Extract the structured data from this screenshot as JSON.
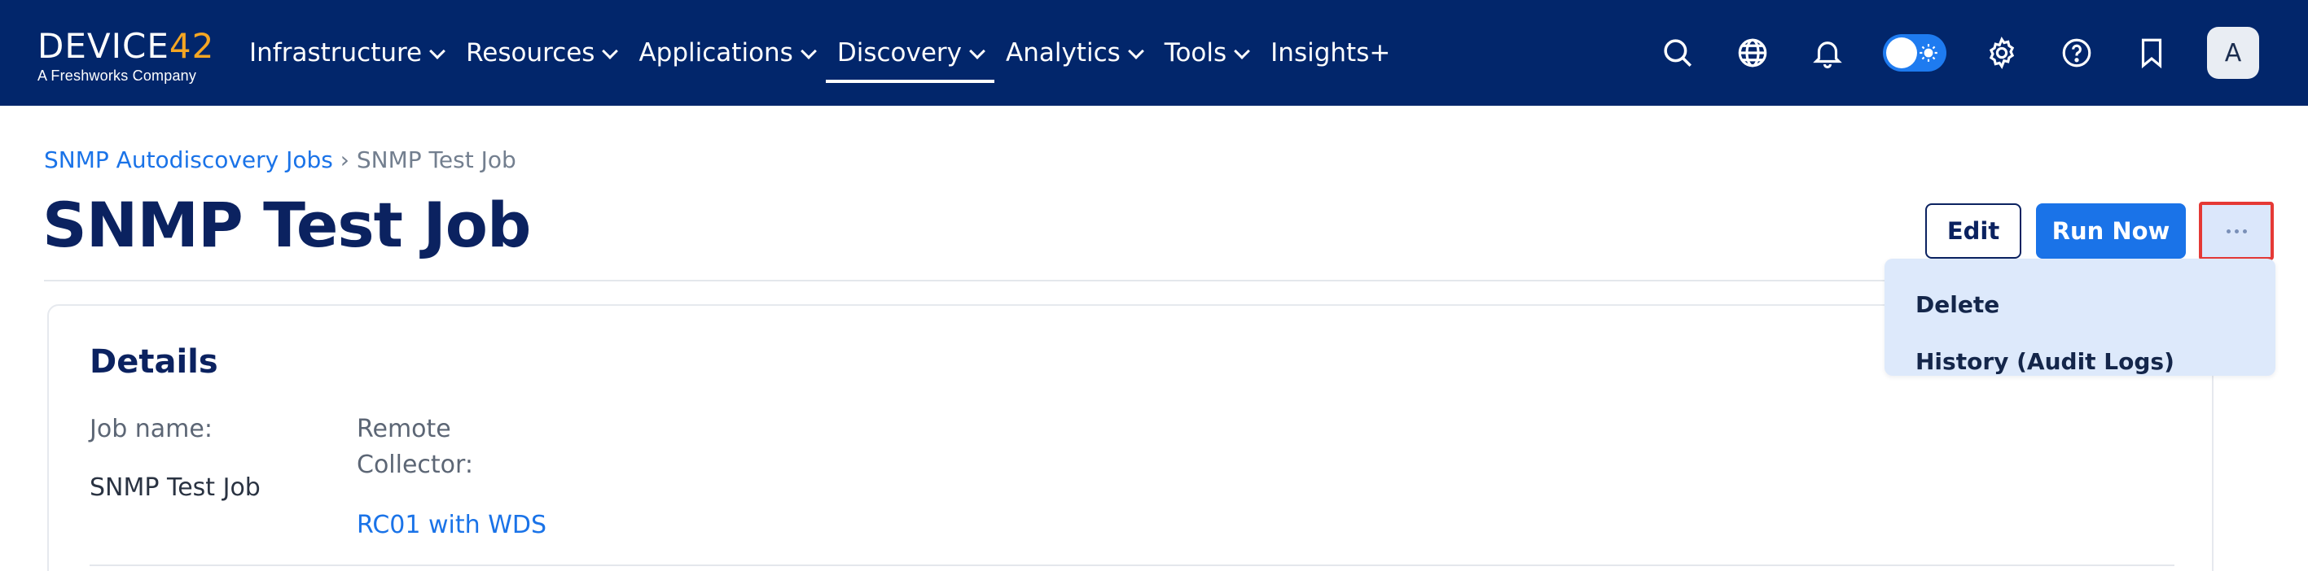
{
  "nav": {
    "logo_main_a": "DEVICE",
    "logo_main_b": "42",
    "logo_sub": "A Freshworks Company",
    "items": [
      {
        "label": "Infrastructure",
        "has_chevron": true
      },
      {
        "label": "Resources",
        "has_chevron": true
      },
      {
        "label": "Applications",
        "has_chevron": true
      },
      {
        "label": "Discovery",
        "has_chevron": true,
        "active": true
      },
      {
        "label": "Analytics",
        "has_chevron": true
      },
      {
        "label": "Tools",
        "has_chevron": true
      },
      {
        "label": "Insights+",
        "has_chevron": false
      }
    ],
    "icons": [
      "search-icon",
      "globe-icon",
      "bell-icon",
      "theme-toggle",
      "gear-icon",
      "help-icon",
      "bookmark-icon"
    ],
    "avatar_initial": "A"
  },
  "breadcrumb": {
    "parent": "SNMP Autodiscovery Jobs",
    "separator": "›",
    "current": "SNMP Test Job"
  },
  "page": {
    "title": "SNMP Test Job"
  },
  "actions": {
    "edit_label": "Edit",
    "run_label": "Run Now",
    "more_label": "···"
  },
  "dropdown": {
    "items": [
      "Delete",
      "History (Audit Logs)"
    ]
  },
  "details": {
    "title": "Details",
    "job_name_label": "Job name:",
    "job_name_value": "SNMP Test Job",
    "remote_collector_label_1": "Remote",
    "remote_collector_label_2": "Collector:",
    "remote_collector_value": "RC01 with WDS"
  },
  "colors": {
    "nav_bg": "#02266b",
    "accent_blue": "#1a73e8",
    "title_navy": "#0b2260",
    "highlight_red": "#e53935",
    "dropdown_bg": "#dde9fb"
  }
}
